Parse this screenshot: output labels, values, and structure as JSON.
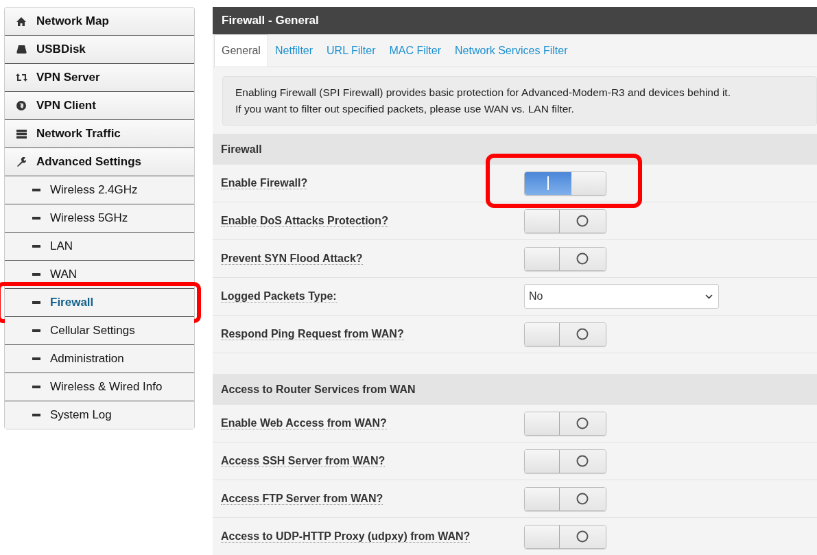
{
  "sidebar": {
    "items": [
      {
        "kind": "main",
        "label": "Network Map",
        "selected": false,
        "highlighted": false
      },
      {
        "kind": "main",
        "label": "USBDisk",
        "selected": false,
        "highlighted": false
      },
      {
        "kind": "main",
        "label": "VPN Server",
        "selected": false,
        "highlighted": false
      },
      {
        "kind": "main",
        "label": "VPN Client",
        "selected": false,
        "highlighted": false
      },
      {
        "kind": "main",
        "label": "Network Traffic",
        "selected": false,
        "highlighted": false
      },
      {
        "kind": "main",
        "label": "Advanced Settings",
        "selected": false,
        "highlighted": false
      },
      {
        "kind": "sub",
        "label": "Wireless 2.4GHz",
        "selected": false,
        "highlighted": false
      },
      {
        "kind": "sub",
        "label": "Wireless 5GHz",
        "selected": false,
        "highlighted": false
      },
      {
        "kind": "sub",
        "label": "LAN",
        "selected": false,
        "highlighted": false
      },
      {
        "kind": "sub",
        "label": "WAN",
        "selected": false,
        "highlighted": false
      },
      {
        "kind": "sub",
        "label": "Firewall",
        "selected": true,
        "highlighted": true
      },
      {
        "kind": "sub",
        "label": "Cellular Settings",
        "selected": false,
        "highlighted": false
      },
      {
        "kind": "sub",
        "label": "Administration",
        "selected": false,
        "highlighted": false
      },
      {
        "kind": "sub",
        "label": "Wireless & Wired Info",
        "selected": false,
        "highlighted": false
      },
      {
        "kind": "sub",
        "label": "System Log",
        "selected": false,
        "highlighted": false
      }
    ]
  },
  "panel": {
    "title": "Firewall - General",
    "tabs": [
      {
        "label": "General",
        "selected": true
      },
      {
        "label": "Netfilter",
        "selected": false
      },
      {
        "label": "URL Filter",
        "selected": false
      },
      {
        "label": "MAC Filter",
        "selected": false
      },
      {
        "label": "Network Services Filter",
        "selected": false
      }
    ],
    "notice": [
      "Enabling Firewall (SPI Firewall) provides basic protection for Advanced-Modem-R3 and devices behind it.",
      "If you want to filter out specified packets, please use WAN vs. LAN filter."
    ],
    "sections": [
      {
        "title": "Firewall",
        "rows": [
          {
            "kind": "switch",
            "label": "Enable Firewall?",
            "on": true,
            "highlighted": true
          },
          {
            "kind": "switch",
            "label": "Enable DoS Attacks Protection?",
            "on": false,
            "highlighted": false
          },
          {
            "kind": "switch",
            "label": "Prevent SYN Flood Attack?",
            "on": false,
            "highlighted": false
          },
          {
            "kind": "select",
            "label": "Logged Packets Type:",
            "value": "No"
          },
          {
            "kind": "switch",
            "label": "Respond Ping Request from WAN?",
            "on": false,
            "highlighted": false
          }
        ]
      },
      {
        "title": "Access to Router Services from WAN",
        "rows": [
          {
            "kind": "switch",
            "label": "Enable Web Access from WAN?",
            "on": false,
            "highlighted": false
          },
          {
            "kind": "switch",
            "label": "Access SSH Server from WAN?",
            "on": false,
            "highlighted": false
          },
          {
            "kind": "switch",
            "label": "Access FTP Server from WAN?",
            "on": false,
            "highlighted": false
          },
          {
            "kind": "switch",
            "label": "Access to UDP-HTTP Proxy (udpxy) from WAN?",
            "on": false,
            "highlighted": false
          }
        ]
      }
    ]
  }
}
